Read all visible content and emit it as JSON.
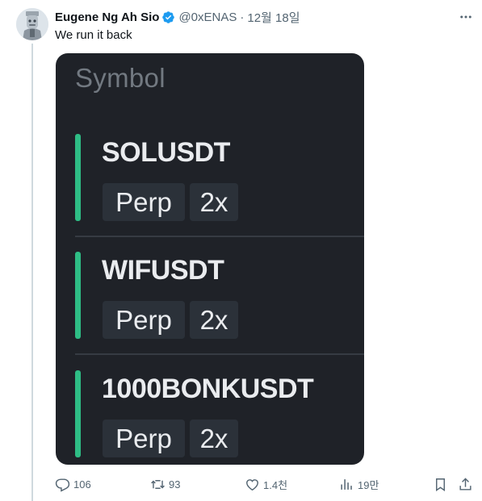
{
  "tweet": {
    "display_name": "Eugene Ng Ah Sio",
    "handle": "@0xENAS",
    "separator": "·",
    "date": "12월 18일",
    "text": "We run it back",
    "verified": true
  },
  "media": {
    "column_header": "Symbol",
    "rows": [
      {
        "symbol": "SOLUSDT",
        "type": "Perp",
        "leverage": "2x"
      },
      {
        "symbol": "WIFUSDT",
        "type": "Perp",
        "leverage": "2x"
      },
      {
        "symbol": "1000BONKUSDT",
        "type": "Perp",
        "leverage": "2x"
      }
    ],
    "accent_color": "#2ebd85",
    "background_color": "#1f2228"
  },
  "actions": {
    "replies": "106",
    "reposts": "93",
    "likes": "1.4천",
    "views": "19만"
  },
  "icons": {
    "verified": "verified-badge-icon",
    "more": "more-icon",
    "reply": "reply-icon",
    "repost": "repost-icon",
    "like": "heart-icon",
    "views": "views-icon",
    "bookmark": "bookmark-icon",
    "share": "share-icon"
  },
  "colors": {
    "verified_blue": "#1d9bf0",
    "secondary_text": "#536471",
    "thread_line": "#cfd9de"
  }
}
